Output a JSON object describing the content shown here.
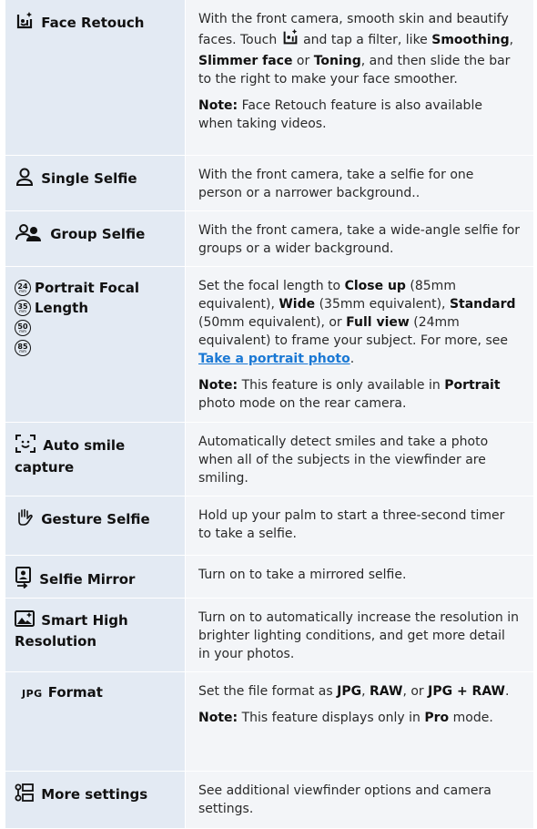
{
  "rows": [
    {
      "feature": "Face Retouch",
      "icon": "face-retouch-icon",
      "desc_parts": [
        "With the front camera, smooth skin and beautify faces. Touch ",
        " and tap a filter, like ",
        "Smoothing",
        ", ",
        "Slimmer face",
        " or ",
        "Toning",
        ", and then slide the bar to the right to make your face smoother."
      ],
      "note_label": "Note:",
      "note_text": " Face Retouch feature is also available when taking videos."
    },
    {
      "feature": "Single Selfie",
      "icon": "single-person-icon",
      "desc": "With the front camera, take a selfie for one person or a narrower background.."
    },
    {
      "feature": "Group Selfie",
      "icon": "group-people-icon",
      "desc": "With the front camera, take a wide-angle selfie for groups or a wider background."
    },
    {
      "feature_line1": "Portrait Focal",
      "feature_line2": "Length",
      "icons": [
        {
          "num": "24",
          "unit": "mm"
        },
        {
          "num": "35",
          "unit": "mm"
        },
        {
          "num": "50",
          "unit": "mm"
        },
        {
          "num": "85",
          "unit": "mm"
        }
      ],
      "desc_parts": [
        "Set the focal length to ",
        "Close up",
        " (85mm equivalent), ",
        "Wide",
        " (35mm equivalent), ",
        "Standard",
        " (50mm equivalent), or ",
        "Full view",
        " (24mm equivalent) to frame your subject. For more, see ",
        "Take a portrait photo",
        "."
      ],
      "note_label": "Note:",
      "note_parts": [
        " This feature is only available in ",
        "Portrait",
        " photo mode on the rear camera."
      ]
    },
    {
      "feature_line1": "Auto smile",
      "feature_line2": "capture",
      "icon": "smile-frame-icon",
      "desc": "Automatically detect smiles and take a photo when all of the subjects in the viewfinder are smiling."
    },
    {
      "feature": "Gesture Selfie",
      "icon": "palm-hand-icon",
      "desc": "Hold up your palm to start a three-second timer to take a selfie."
    },
    {
      "feature": "Selfie Mirror",
      "icon": "selfie-mirror-icon",
      "desc": "Turn on to take a mirrored selfie."
    },
    {
      "feature_line1": "Smart High",
      "feature_line2": "Resolution",
      "icon": "smart-high-res-icon",
      "desc": "Turn on to automatically increase the resolution in brighter lighting conditions, and get more detail in your photos."
    },
    {
      "feature": "Format",
      "icon_text": "JPG",
      "desc_parts": [
        "Set the file format as ",
        "JPG",
        ", ",
        "RAW",
        ", or ",
        "JPG + RAW",
        "."
      ],
      "note_label": "Note:",
      "note_parts": [
        " This feature displays only in ",
        "Pro",
        " mode."
      ]
    },
    {
      "feature": "More settings",
      "icon": "more-settings-icon",
      "desc": "See additional viewfinder options and camera settings."
    }
  ]
}
